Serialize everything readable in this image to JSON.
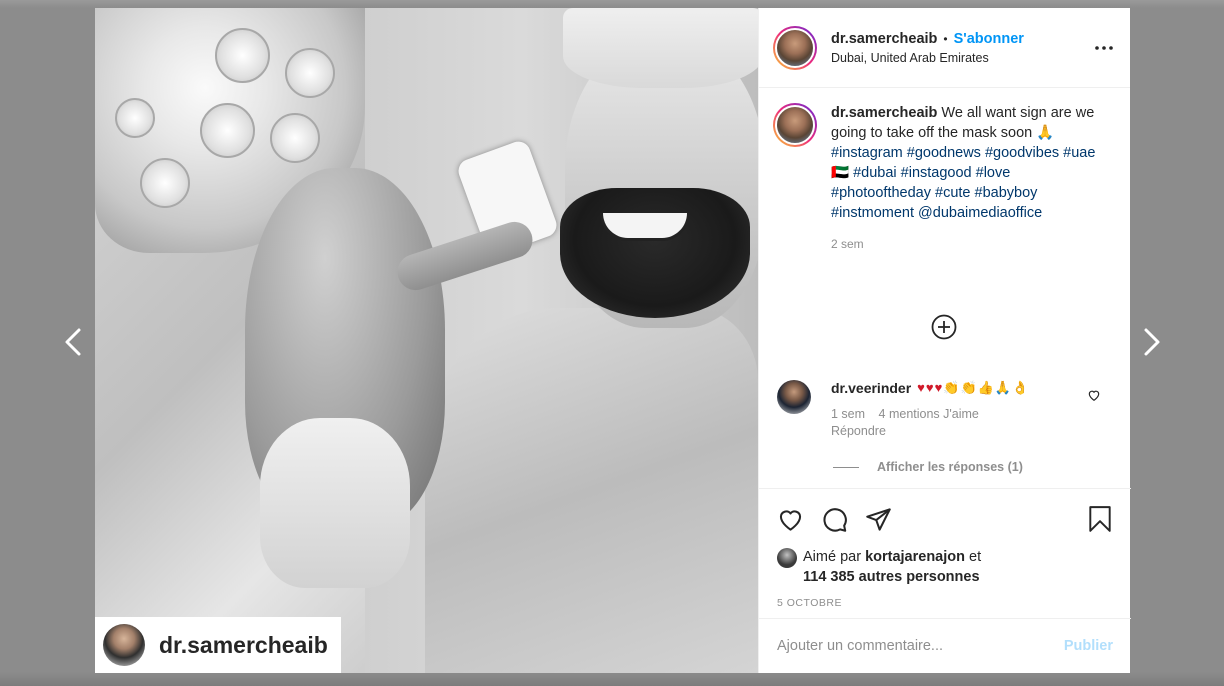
{
  "post": {
    "username": "dr.samercheaib",
    "follow_label": "S'abonner",
    "separator": "•",
    "location": "Dubai, United Arab Emirates",
    "photo_credit": "dr.samercheaib"
  },
  "caption": {
    "username": "dr.samercheaib",
    "text_start": "We all want sign are we going to take off the mask soon 🙏",
    "hashtags_line": "#instagram #goodnews #goodvibes #uae🇦🇪 #dubai #instagood #love #photooftheday #cute #babyboy #instmoment",
    "mention": "@dubaimediaoffice",
    "time": "2 sem"
  },
  "comment": {
    "username": "dr.veerinder",
    "emojis": "♥♥♥👏👏👍🙏👌",
    "time": "1 sem",
    "likes": "4 mentions J'aime",
    "reply_label": "Répondre",
    "view_replies": "Afficher les réponses (1)"
  },
  "likes": {
    "prefix": "Aimé par",
    "liker": "kortajarenajon",
    "connector": "et",
    "others": "114 385 autres personnes"
  },
  "date": "5 OCTOBRE",
  "add_comment": {
    "placeholder": "Ajouter un commentaire...",
    "post_label": "Publier"
  },
  "icons": {
    "prev": "chevron-left-icon",
    "next": "chevron-right-icon",
    "more": "more-horizontal-icon",
    "like": "heart-icon",
    "comment": "comment-bubble-icon",
    "share": "paper-plane-icon",
    "save": "bookmark-icon",
    "load_more": "plus-circle-icon"
  },
  "colors": {
    "follow": "#0095f6",
    "hashtag": "#00376b",
    "muted": "#8e8e8e",
    "post_disabled": "#b2dffc"
  }
}
